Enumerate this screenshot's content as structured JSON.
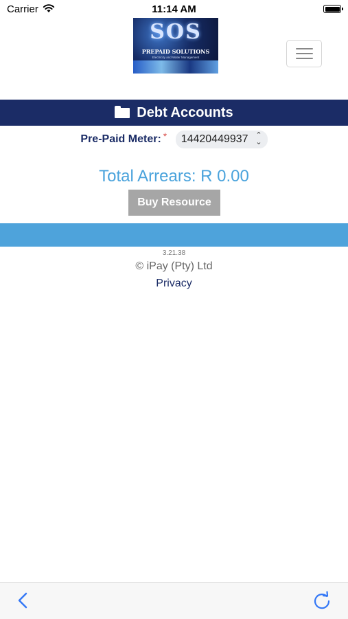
{
  "status_bar": {
    "carrier": "Carrier",
    "time": "11:14 AM"
  },
  "logo": {
    "title": "SOS",
    "subtitle": "PREPAID SOLUTIONS",
    "tagline": "Electricity and Water Management"
  },
  "header": {
    "title": "Debt Accounts",
    "icon": "folder-icon"
  },
  "meter": {
    "label": "Pre-Paid Meter:",
    "required_mark": "*",
    "selected": "14420449937"
  },
  "arrears": {
    "text": "Total Arrears: R 0.00"
  },
  "buy_button": {
    "label": "Buy Resource"
  },
  "footer": {
    "version": "3.21.38",
    "copyright": "© iPay (Pty) Ltd",
    "privacy": "Privacy"
  },
  "colors": {
    "header_bg": "#1b2c66",
    "accent_blue": "#4ea3db",
    "arrears_text": "#4aa3dc",
    "button_disabled": "#a6a6a6"
  },
  "browser_nav": {
    "back_icon": "chevron-left-icon",
    "reload_icon": "reload-icon"
  }
}
